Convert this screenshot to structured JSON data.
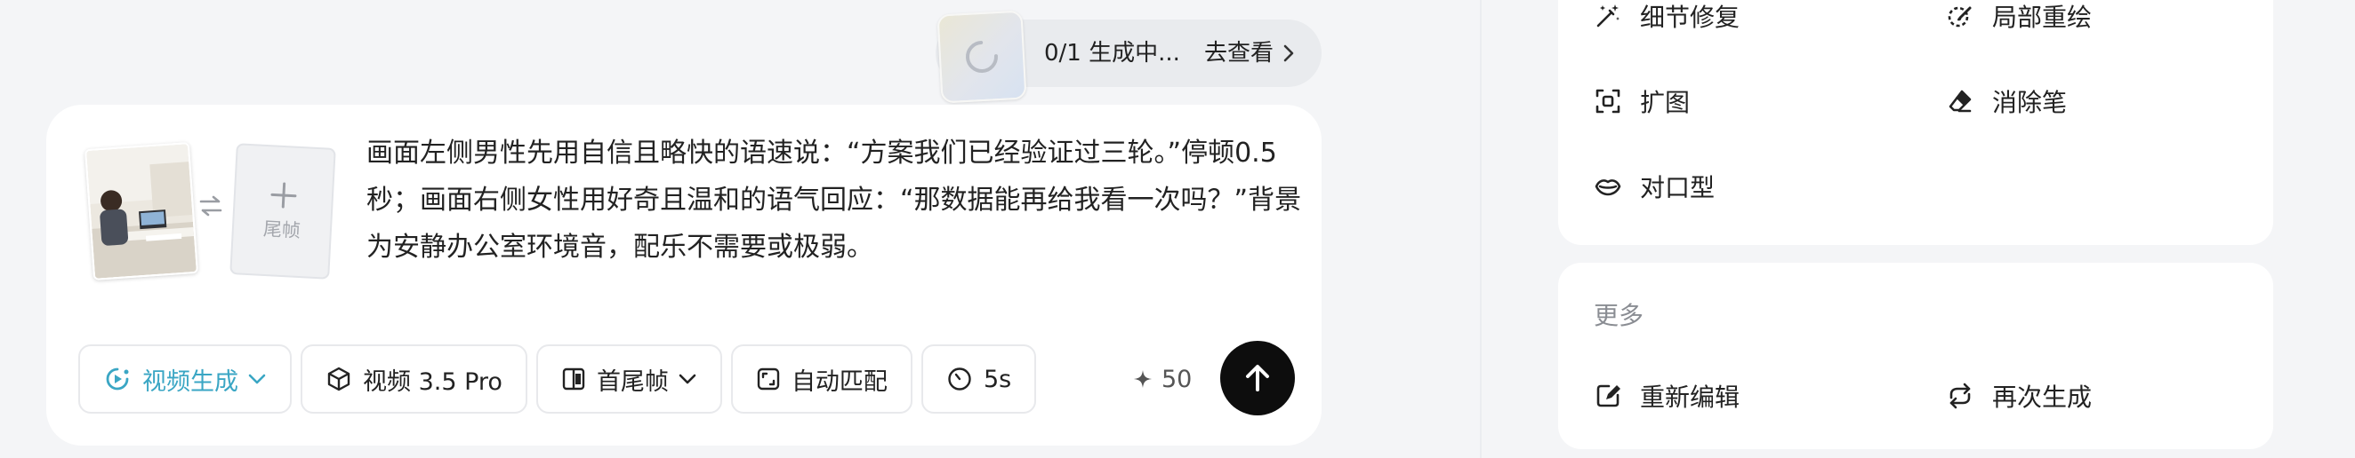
{
  "status": {
    "progress_text": "0/1 生成中...",
    "link_text": "去查看"
  },
  "prompt": {
    "end_frame_label": "尾帧",
    "text": "画面左侧男性先用自信且略快的语速说：“方案我们已经验证过三轮。”停顿0.5秒；画面右侧女性用好奇且温和的语气回应：“那数据能再给我看一次吗？”背景为安静办公室环境音，配乐不需要或极弱。"
  },
  "toolbar": {
    "mode_label": "视频生成",
    "model_label": "视频 3.5 Pro",
    "frame_label": "首尾帧",
    "ratio_label": "自动匹配",
    "duration_label": "5s",
    "credits": "50"
  },
  "tools": {
    "items": [
      {
        "label": "细节修复",
        "icon": "magic-wand-icon"
      },
      {
        "label": "局部重绘",
        "icon": "partial-redraw-icon"
      },
      {
        "label": "扩图",
        "icon": "expand-icon"
      },
      {
        "label": "消除笔",
        "icon": "eraser-icon"
      },
      {
        "label": "对口型",
        "icon": "lips-icon"
      }
    ]
  },
  "more": {
    "title": "更多",
    "items": [
      {
        "label": "重新编辑",
        "icon": "edit-icon"
      },
      {
        "label": "再次生成",
        "icon": "regenerate-icon"
      }
    ]
  },
  "colors": {
    "accent": "#3aa6c4",
    "send_button": "#0d0d0d",
    "background": "#f4f5f7"
  }
}
